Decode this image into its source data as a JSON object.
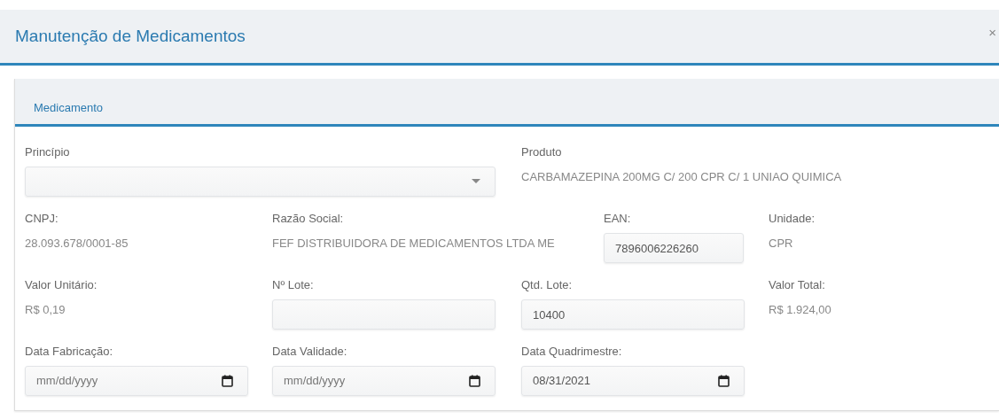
{
  "modal": {
    "title": "Manutenção de Medicamentos",
    "close": "×"
  },
  "panel": {
    "tabs": [
      {
        "label": "Medicamento",
        "selected": true
      }
    ],
    "rows": [
      [
        {
          "kind": "select",
          "label": "Princípio"
        },
        {
          "kind": "text",
          "label": "Produto",
          "value": "CARBAMAZEPINA 200MG C/ 200 CPR C/ 1 UNIAO QUIMICA"
        }
      ],
      [
        {
          "kind": "text",
          "label": "CNPJ:",
          "value": "28.093.678/0001-85"
        },
        {
          "kind": "text",
          "label": "Razão Social:",
          "value": "FEF DISTRIBUIDORA DE MEDICAMENTOS LTDA ME"
        },
        {
          "kind": "input",
          "label": "EAN:",
          "value": "7896006226260"
        },
        {
          "kind": "text",
          "label": "Unidade:",
          "value": "CPR"
        }
      ],
      [
        {
          "kind": "text",
          "label": "Valor Unitário:",
          "value": "R$ 0,19"
        },
        {
          "kind": "input",
          "label": "Nº Lote:"
        },
        {
          "kind": "input",
          "label": "Qtd. Lote:",
          "value": "10400"
        },
        {
          "kind": "text",
          "label": "Valor Total:",
          "value": "R$ 1.924,00"
        }
      ],
      [
        {
          "kind": "date",
          "label": "Data Fabricação:",
          "placeholder": "mm/dd/yyyy"
        },
        {
          "kind": "date",
          "label": "Data Validade:",
          "placeholder": "mm/dd/yyyy"
        },
        {
          "kind": "date",
          "label": "Data Quadrimestre:",
          "value": "08/31/2021"
        }
      ]
    ]
  }
}
